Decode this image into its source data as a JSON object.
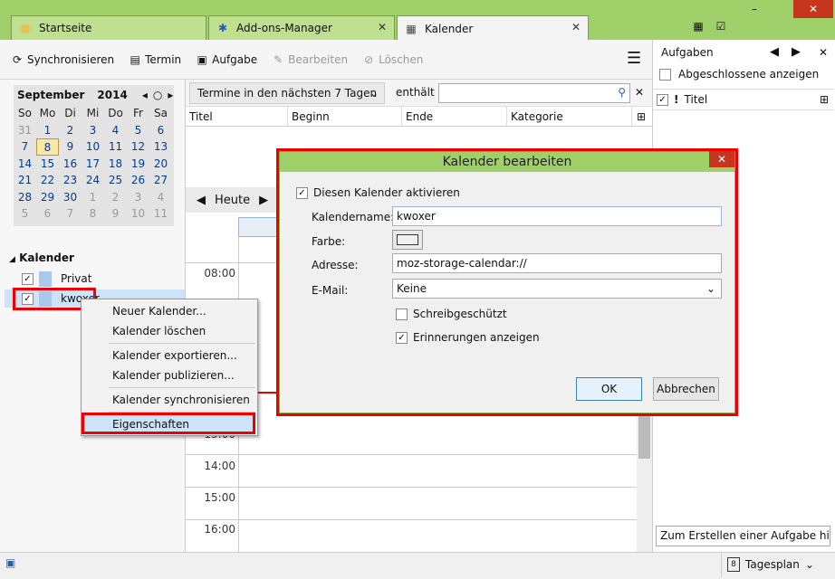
{
  "tabs": [
    {
      "label": "Startseite",
      "icon": "folder-icon"
    },
    {
      "label": "Add-ons-Manager",
      "icon": "puzzle-icon"
    },
    {
      "label": "Kalender",
      "icon": "calendar-icon"
    }
  ],
  "window": {
    "minimize": "–",
    "close": "✕"
  },
  "toolbar": {
    "sync": "Synchronisieren",
    "event": "Termin",
    "task": "Aufgabe",
    "edit": "Bearbeiten",
    "delete": "Löschen"
  },
  "minimonth": {
    "month": "September",
    "year": "2014",
    "weekdays": [
      "So",
      "Mo",
      "Di",
      "Mi",
      "Do",
      "Fr",
      "Sa"
    ],
    "days": [
      "31",
      "1",
      "2",
      "3",
      "4",
      "5",
      "6",
      "7",
      "8",
      "9",
      "10",
      "11",
      "12",
      "13",
      "14",
      "15",
      "16",
      "17",
      "18",
      "19",
      "20",
      "21",
      "22",
      "23",
      "24",
      "25",
      "26",
      "27",
      "28",
      "29",
      "30",
      "1",
      "2",
      "3",
      "4",
      "5",
      "6",
      "7",
      "8",
      "9",
      "10",
      "11"
    ],
    "selected": "8"
  },
  "calendars": {
    "heading": "Kalender",
    "items": [
      {
        "name": "Privat",
        "color": "#a8c8ec"
      },
      {
        "name": "kwoxer",
        "color": "#a8c8ec"
      }
    ]
  },
  "filter": {
    "select": "Termine in den nächsten 7 Tagen",
    "contains": "enthält",
    "search_value": ""
  },
  "columns": [
    "Titel",
    "Beginn",
    "Ende",
    "Kategorie"
  ],
  "dayview": {
    "today": "Heute",
    "hours": [
      "08:00",
      "13:00",
      "14:00",
      "15:00",
      "16:00"
    ]
  },
  "tasks": {
    "heading": "Aufgaben",
    "show_completed": "Abgeschlossene anzeigen",
    "col_title": "Titel",
    "new_task_placeholder": "Zum Erstellen einer Aufgabe hier kl"
  },
  "status": {
    "view": "Tagesplan",
    "cal_day": "8"
  },
  "dialog": {
    "title": "Kalender bearbeiten",
    "enable": "Diesen Kalender aktivieren",
    "name_label": "Kalendername:",
    "name_value": "kwoxer",
    "color_label": "Farbe:",
    "address_label": "Adresse:",
    "address_value": "moz-storage-calendar://",
    "email_label": "E-Mail:",
    "email_value": "Keine",
    "readonly": "Schreibgeschützt",
    "reminders": "Erinnerungen anzeigen",
    "ok": "OK",
    "cancel": "Abbrechen"
  },
  "context_menu": [
    "Neuer Kalender...",
    "Kalender löschen",
    "Kalender exportieren...",
    "Kalender publizieren...",
    "Kalender synchronisieren",
    "Eigenschaften"
  ],
  "colors": {
    "accent": "#9fd06a",
    "highlight": "#e00000",
    "selection": "#cde3f7"
  }
}
